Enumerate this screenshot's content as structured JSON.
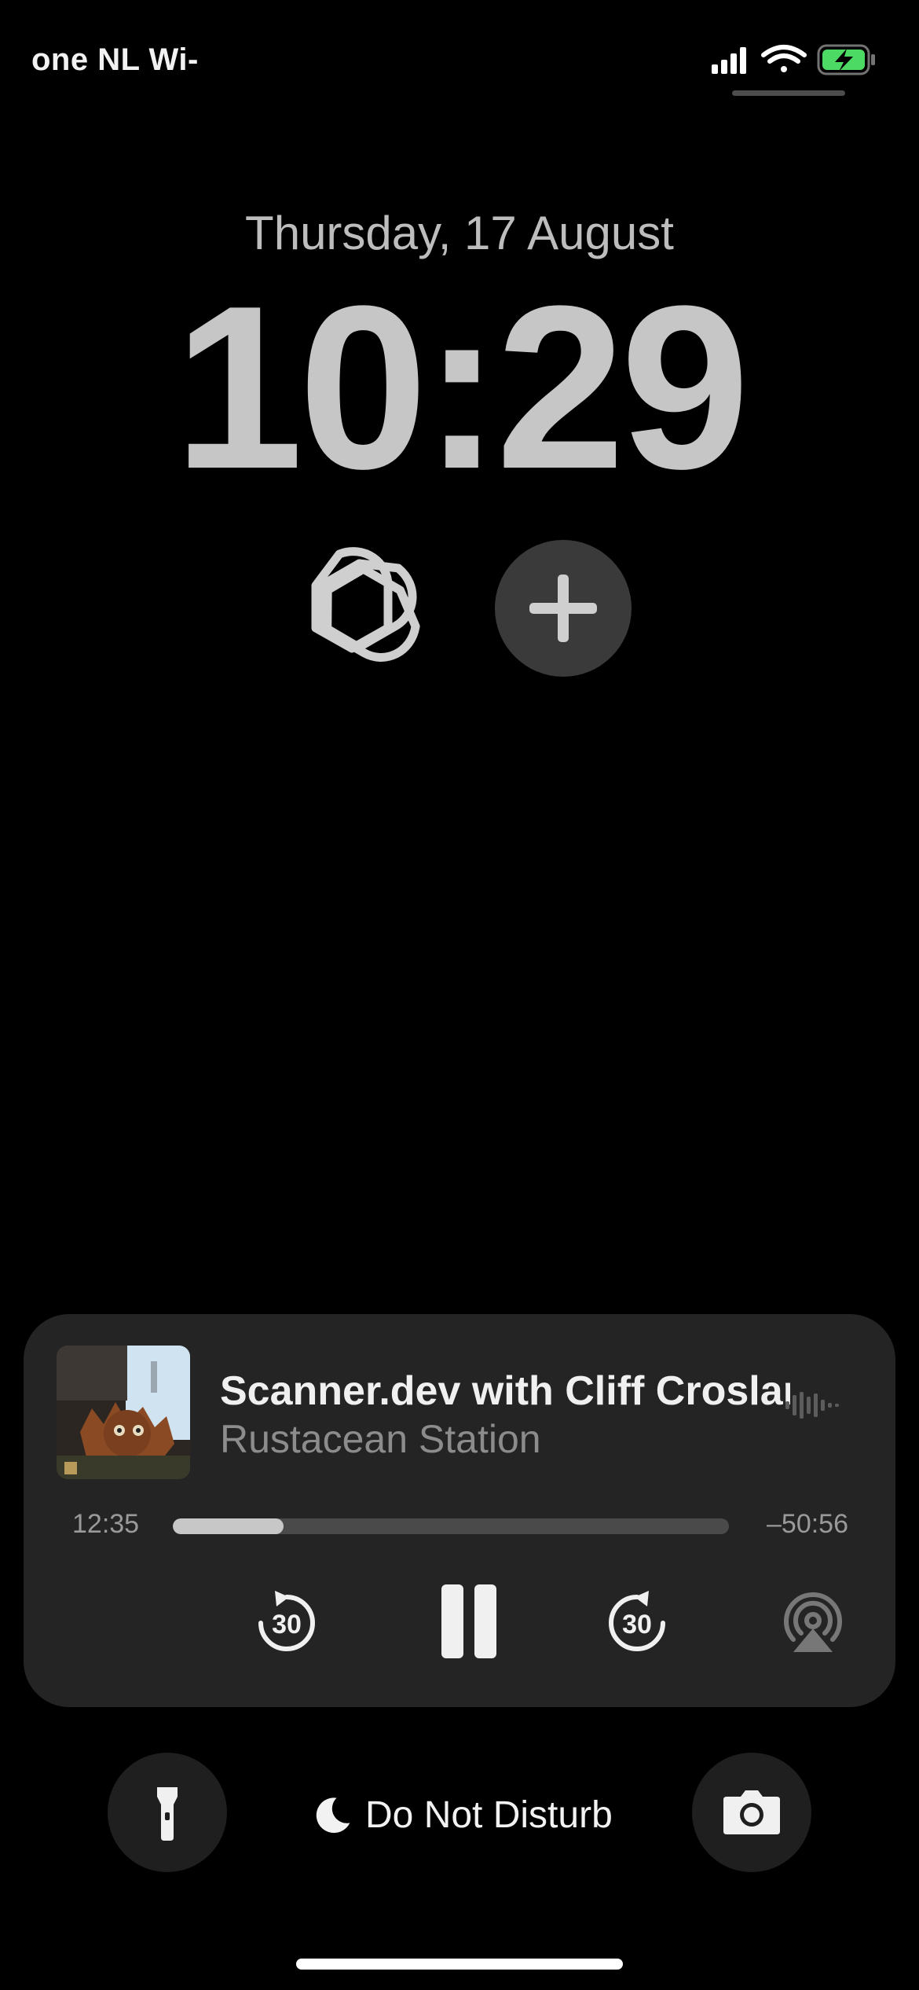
{
  "status_bar": {
    "carrier": "one NL Wi-",
    "icons": [
      "cellular-signal-icon",
      "wifi-icon",
      "battery-charging-icon"
    ],
    "battery_color": "#4cd964"
  },
  "lock_screen": {
    "date": "Thursday, 17 August",
    "time": "10:29",
    "widgets": [
      "chatgpt-logo-icon",
      "add-widget-icon"
    ]
  },
  "now_playing": {
    "title": "Scanner.dev with Cliff Crosland",
    "show": "Rustacean Station",
    "elapsed": "12:35",
    "remaining": "–50:56",
    "progress_fraction": 0.199,
    "skip_back_seconds": "30",
    "skip_forward_seconds": "30",
    "icons": [
      "skip-back-30-icon",
      "pause-icon",
      "skip-forward-30-icon",
      "airplay-icon",
      "audio-waveform-icon"
    ]
  },
  "bottom": {
    "left_button": "flashlight-icon",
    "focus_label": "Do Not Disturb",
    "focus_icon": "moon-icon",
    "right_button": "camera-icon"
  }
}
